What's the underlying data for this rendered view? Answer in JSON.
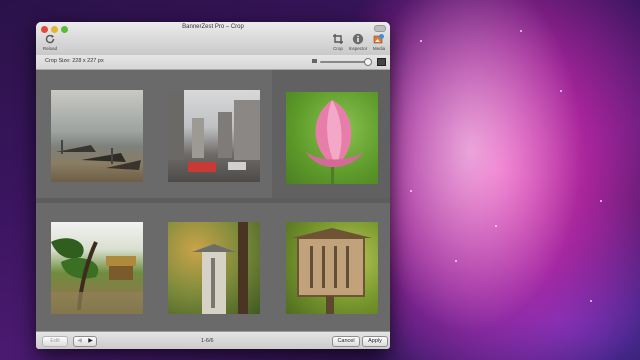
{
  "window": {
    "title": "BannerZest Pro – Crop"
  },
  "toolbar": {
    "reload_label": "Reload",
    "crop_label": "Crop",
    "inspector_label": "Inspector",
    "media_label": "Media"
  },
  "infobar": {
    "crop_size": "Crop Size: 228 x 227 px",
    "zoom_level": 0.9
  },
  "photos": [
    {
      "subject": "boats-on-beach"
    },
    {
      "subject": "city-street"
    },
    {
      "subject": "pink-lotus"
    },
    {
      "subject": "pine-garden"
    },
    {
      "subject": "stone-sign"
    },
    {
      "subject": "wooden-sign"
    }
  ],
  "footer": {
    "edit_label": "Edit",
    "prev_arrow": "◀",
    "next_arrow": "▶",
    "counter": "1-6/6",
    "cancel_label": "Cancel",
    "apply_label": "Apply"
  }
}
